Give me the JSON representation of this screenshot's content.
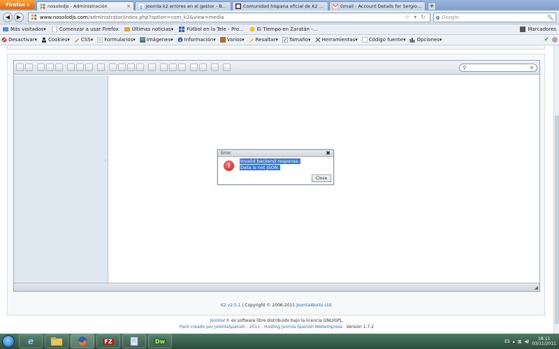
{
  "browser": {
    "app_button": "Firefox",
    "tabs": [
      {
        "label": "nosolodjs - Administración",
        "active": true
      },
      {
        "label": "joomla k2 errores en el gestor - Busca...",
        "active": false
      },
      {
        "label": "Comunidad hispana oficial de K2 - K2...",
        "active": false
      },
      {
        "label": "Gmail - Account Details for Sergio Ga...",
        "active": false
      }
    ],
    "new_tab": "+",
    "url_host": "www.nosolodjs.com",
    "url_path": "/administrator/index.php?option=com_k2&view=media",
    "search_placeholder": "Google",
    "search_engine_mark": "g"
  },
  "bookmarks": {
    "items": [
      "Más visitados",
      "Comenzar a usar Firefox",
      "Últimas noticias",
      "Fútbol en la Tele - Pro...",
      "El Tiempo en Zaratán -..."
    ],
    "right": "Marcadores"
  },
  "devbar": {
    "items": [
      "Desactivar",
      "Cookies",
      "CSS",
      "Formularios",
      "Imágenes",
      "Información",
      "Varios",
      "Resaltar",
      "Tamaño",
      "Herramientas",
      "Código fuente",
      "Opciones"
    ]
  },
  "dialog": {
    "title": "Error",
    "close": "✖",
    "message_line1": "Invalid backend response.",
    "message_line2": "Data is not JSON.",
    "button": "Close",
    "icon": "!"
  },
  "k2": {
    "credit_version": "K2 v2.5.1",
    "credit_middle": " | Copyright © 2006-2011 ",
    "credit_company": "JoomlaWorks Ltd."
  },
  "footer": {
    "line1_link": "Joomla!®",
    "line1_text": " es software libre distribuido bajo la licencia GNU/GPL.",
    "line2_link": "Pack creado por JoomlaSpanish - 2011 - Hosting Joomla Spanish Webempresa",
    "line2_version": "Versión 1.7.2"
  },
  "taskbar": {
    "apps": [
      "e",
      "",
      "",
      "FZ",
      "",
      "Dw"
    ],
    "language": "ES",
    "time": "18:11",
    "date": "03/11/2011"
  },
  "colors": {
    "accent": "#3a7ad4",
    "error": "#cc1111",
    "link": "#3a6ab5"
  }
}
